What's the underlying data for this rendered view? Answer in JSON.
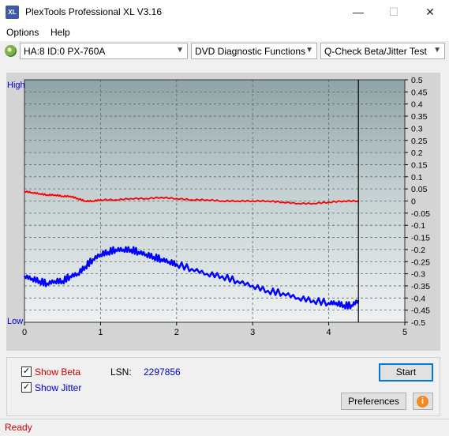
{
  "window": {
    "title": "PlexTools Professional XL V3.16",
    "icon_label": "XL",
    "minimize": "—",
    "maximize": "☐",
    "close": "✕"
  },
  "menu": {
    "options": "Options",
    "help": "Help"
  },
  "toolbar": {
    "drive": "HA:8 ID:0  PX-760A",
    "function": "DVD Diagnostic Functions",
    "test": "Q-Check Beta/Jitter Test",
    "dropdown_icon": "chevron-down-icon"
  },
  "chart_data": {
    "type": "line",
    "y_left_top": "High",
    "y_left_bottom": "Low",
    "xlim": [
      0,
      5
    ],
    "ylim": [
      -0.5,
      0.5
    ],
    "x_ticks": [
      "0",
      "1",
      "2",
      "3",
      "4",
      "5"
    ],
    "y_ticks": [
      "0.5",
      "0.45",
      "0.4",
      "0.35",
      "0.3",
      "0.25",
      "0.2",
      "0.15",
      "0.1",
      "0.05",
      "0",
      "-0.05",
      "-0.1",
      "-0.15",
      "-0.2",
      "-0.25",
      "-0.3",
      "-0.35",
      "-0.4",
      "-0.45",
      "-0.5"
    ],
    "grid": true,
    "end_marker_x": 4.39,
    "colors": {
      "beta": "#ff0000",
      "jitter": "#0000ff",
      "marker": "#000000"
    },
    "series": [
      {
        "id": "beta",
        "x": [
          0,
          0.1,
          0.2,
          0.3,
          0.4,
          0.5,
          0.6,
          0.7,
          0.8,
          0.9,
          1.0,
          1.2,
          1.4,
          1.6,
          1.8,
          2.0,
          2.2,
          2.4,
          2.6,
          2.8,
          3.0,
          3.2,
          3.4,
          3.6,
          3.8,
          4.0,
          4.2,
          4.39
        ],
        "y": [
          0.04,
          0.035,
          0.03,
          0.025,
          0.025,
          0.02,
          0.02,
          0.01,
          0.0,
          0.0,
          0.005,
          0.005,
          0.01,
          0.01,
          0.015,
          0.01,
          0.005,
          0.005,
          0.0,
          0.0,
          0.0,
          0.0,
          -0.005,
          -0.01,
          -0.01,
          -0.005,
          0.0,
          0.0
        ]
      },
      {
        "id": "jitter",
        "x": [
          0,
          0.1,
          0.2,
          0.3,
          0.4,
          0.5,
          0.6,
          0.7,
          0.8,
          0.9,
          1.0,
          1.1,
          1.2,
          1.3,
          1.4,
          1.5,
          1.6,
          1.7,
          1.8,
          1.9,
          2.0,
          2.2,
          2.4,
          2.6,
          2.8,
          3.0,
          3.2,
          3.4,
          3.6,
          3.8,
          4.0,
          4.1,
          4.2,
          4.3,
          4.39
        ],
        "y": [
          -0.31,
          -0.32,
          -0.33,
          -0.34,
          -0.33,
          -0.33,
          -0.31,
          -0.3,
          -0.27,
          -0.24,
          -0.22,
          -0.21,
          -0.2,
          -0.2,
          -0.2,
          -0.21,
          -0.22,
          -0.23,
          -0.24,
          -0.25,
          -0.26,
          -0.28,
          -0.3,
          -0.31,
          -0.33,
          -0.35,
          -0.37,
          -0.38,
          -0.4,
          -0.41,
          -0.42,
          -0.42,
          -0.43,
          -0.43,
          -0.41
        ]
      }
    ]
  },
  "options_panel": {
    "show_beta": "Show Beta",
    "show_jitter": "Show Jitter",
    "lsn_label": "LSN:",
    "lsn_value": "2297856",
    "start_button": "Start",
    "preferences_button": "Preferences",
    "info_icon": "i",
    "check": "✓"
  },
  "status": {
    "text": "Ready"
  }
}
